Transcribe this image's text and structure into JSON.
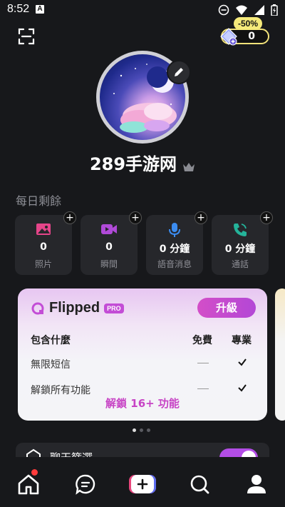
{
  "status_bar": {
    "time": "8:52",
    "notif_letter": "A"
  },
  "header": {
    "discount": "-50%",
    "coins": "0"
  },
  "profile": {
    "username": "289手游网"
  },
  "daily": {
    "title": "每日剩餘",
    "items": [
      {
        "value": "0",
        "label": "照片",
        "icon": "photo-icon",
        "color": "#e6458a"
      },
      {
        "value": "0",
        "label": "瞬間",
        "icon": "video-icon",
        "color": "#b04ad8"
      },
      {
        "value": "0 分鐘",
        "label": "語音消息",
        "icon": "microphone-icon",
        "color": "#3b8cf0"
      },
      {
        "value": "0 分鐘",
        "label": "通話",
        "icon": "phone-icon",
        "color": "#24b39a"
      }
    ]
  },
  "promo": {
    "brand": "Flipped",
    "pro_badge": "PRO",
    "upgrade_label": "升級",
    "headers": {
      "feature": "包含什麼",
      "free": "免費",
      "pro": "專業"
    },
    "rows": [
      {
        "label": "無限短信"
      },
      {
        "label": "解鎖所有功能"
      }
    ],
    "unlock_text": "解鎖 16+ 功能"
  },
  "filter": {
    "label": "聊天篩選"
  },
  "colors": {
    "accent": "#c744c5",
    "background": "#17181b",
    "card": "#26272b"
  }
}
